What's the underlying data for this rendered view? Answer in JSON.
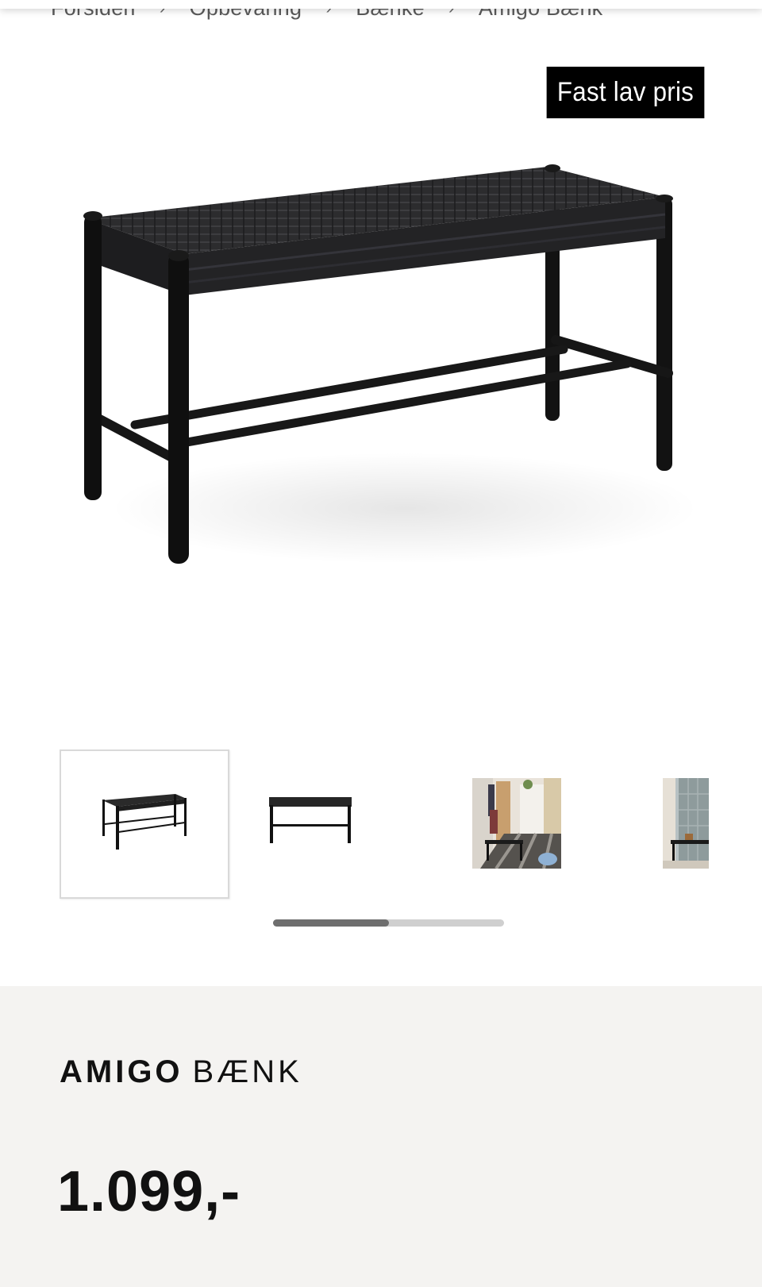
{
  "breadcrumb": {
    "items": [
      "Forsiden",
      "Opbevaring",
      "Bænke",
      "Amigo Bænk"
    ],
    "separator": "›"
  },
  "badge": {
    "label": "Fast lav pris"
  },
  "product": {
    "brand": "AMIGO",
    "kind": "BÆNK",
    "price": "1.099,-"
  },
  "gallery": {
    "thumbnails": [
      "bench-angle",
      "bench-front",
      "bench-hallway-room",
      "bench-room"
    ],
    "selected_index": 0,
    "scroll_position_fraction": 0.5
  },
  "colors": {
    "badge_bg": "#000000",
    "info_panel_bg": "#f4f3f1",
    "scroll_thumb": "#6e6e6e",
    "scroll_track": "#cfcfcf"
  }
}
